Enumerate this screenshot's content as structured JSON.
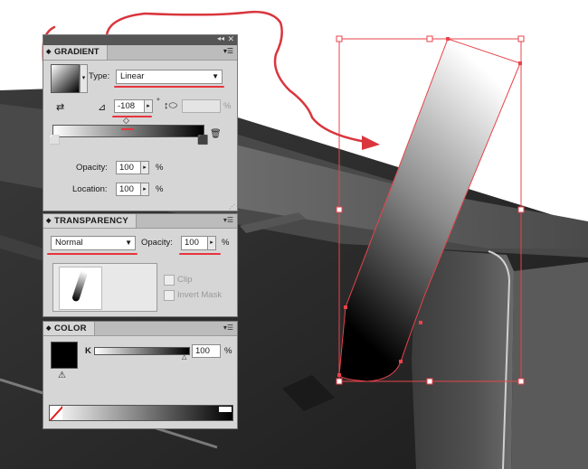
{
  "gradient": {
    "title": "GRADIENT",
    "type_label": "Type:",
    "type_value": "Linear",
    "angle_value": "-108",
    "angle_unit": "°",
    "aspect_unit": "%",
    "opacity_label": "Opacity:",
    "opacity_value": "100",
    "opacity_unit": "%",
    "location_label": "Location:",
    "location_value": "100",
    "location_unit": "%"
  },
  "transparency": {
    "title": "TRANSPARENCY",
    "blend_mode": "Normal",
    "opacity_label": "Opacity:",
    "opacity_value": "100",
    "opacity_unit": "%",
    "clip_label": "Clip",
    "invert_mask_label": "Invert Mask"
  },
  "color": {
    "title": "COLOR",
    "channel_label": "K",
    "channel_value": "100",
    "channel_unit": "%"
  },
  "icons": [
    "collapse-panel-icon",
    "close-panel-icon",
    "panel-menu-icon",
    "reverse-gradient-icon",
    "angle-icon",
    "aspect-ratio-icon",
    "delete-stop-icon",
    "none-swatch-icon",
    "out-of-gamut-icon"
  ],
  "colors": {
    "annotation_red": "#e8343f",
    "panel_bg": "#d6d6d6",
    "scene_dark": "#2f2f2f"
  }
}
